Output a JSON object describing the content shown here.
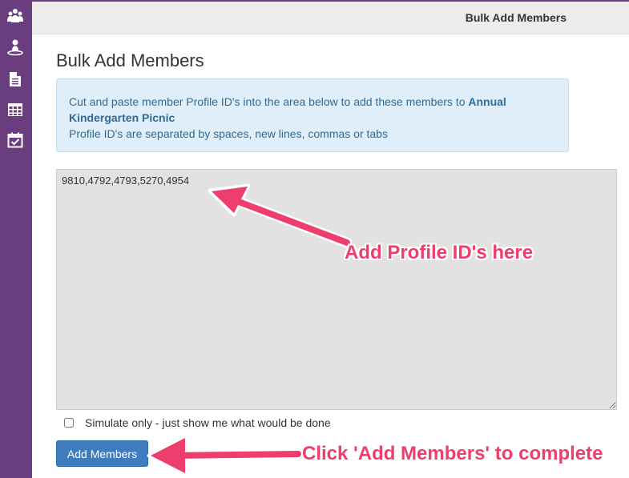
{
  "topbar": {
    "title": "Bulk Add Members"
  },
  "page": {
    "title": "Bulk Add Members"
  },
  "info": {
    "line1_prefix": "Cut and paste member Profile ID's into the area below to add these members to ",
    "event_name": "Annual Kindergarten Picnic",
    "line2": "Profile ID's are separated by spaces, new lines, commas or tabs"
  },
  "textarea": {
    "value": "9810,4792,4793,5270,4954"
  },
  "simulate": {
    "label": "Simulate only - just show me what would be done",
    "checked": false
  },
  "actions": {
    "add_members_label": "Add Members"
  },
  "annotations": {
    "profile_ids": "Add Profile ID's here",
    "complete": "Click 'Add Members' to complete"
  },
  "sidebar": {
    "icons": [
      "people-group-icon",
      "person-icon",
      "document-icon",
      "table-icon",
      "calendar-check-icon"
    ]
  },
  "colors": {
    "sidebar": "#6a3d7f",
    "info_bg": "#dfeef9",
    "info_text": "#2f6b97",
    "button": "#3f7cbf",
    "annotation": "#ee3e6d"
  }
}
